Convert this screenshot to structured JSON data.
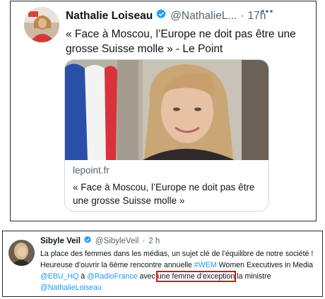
{
  "tweet1": {
    "name": "Nathalie Loiseau",
    "handle": "@NathalieL...",
    "time": "17h",
    "text": "« Face à Moscou, l’Europe ne doit pas être une grosse Suisse molle » - Le Point",
    "card": {
      "domain": "lepoint.fr",
      "title": "« Face à Moscou, l’Europe ne doit pas être une grosse Suisse molle »"
    }
  },
  "tweet2": {
    "name": "Sibyle Veil",
    "handle": "@SibyleVeil",
    "time": "2 h",
    "text": {
      "part1": "La place des femmes dans les médias, un sujet clé de l’équilibre de notre société ! Heureuse d’ouvrir la 6ème rencontre annuelle ",
      "hashtag": "#WEM",
      "part2": " Women Executives in Media ",
      "mention1": "@EBU_HQ",
      "part3": " à ",
      "mention2": "@RadioFrance",
      "part4": " avec ",
      "highlight": "une femme d’exception",
      "part5": " la ministre ",
      "mention3": "@NathalieLoiseau"
    }
  },
  "icons": {
    "verified": "verified-badge-icon",
    "more": "more-options-icon"
  },
  "colors": {
    "link": "#1d9bf0",
    "verified": "#1d9bf0",
    "highlight_border": "#d11a1a"
  }
}
